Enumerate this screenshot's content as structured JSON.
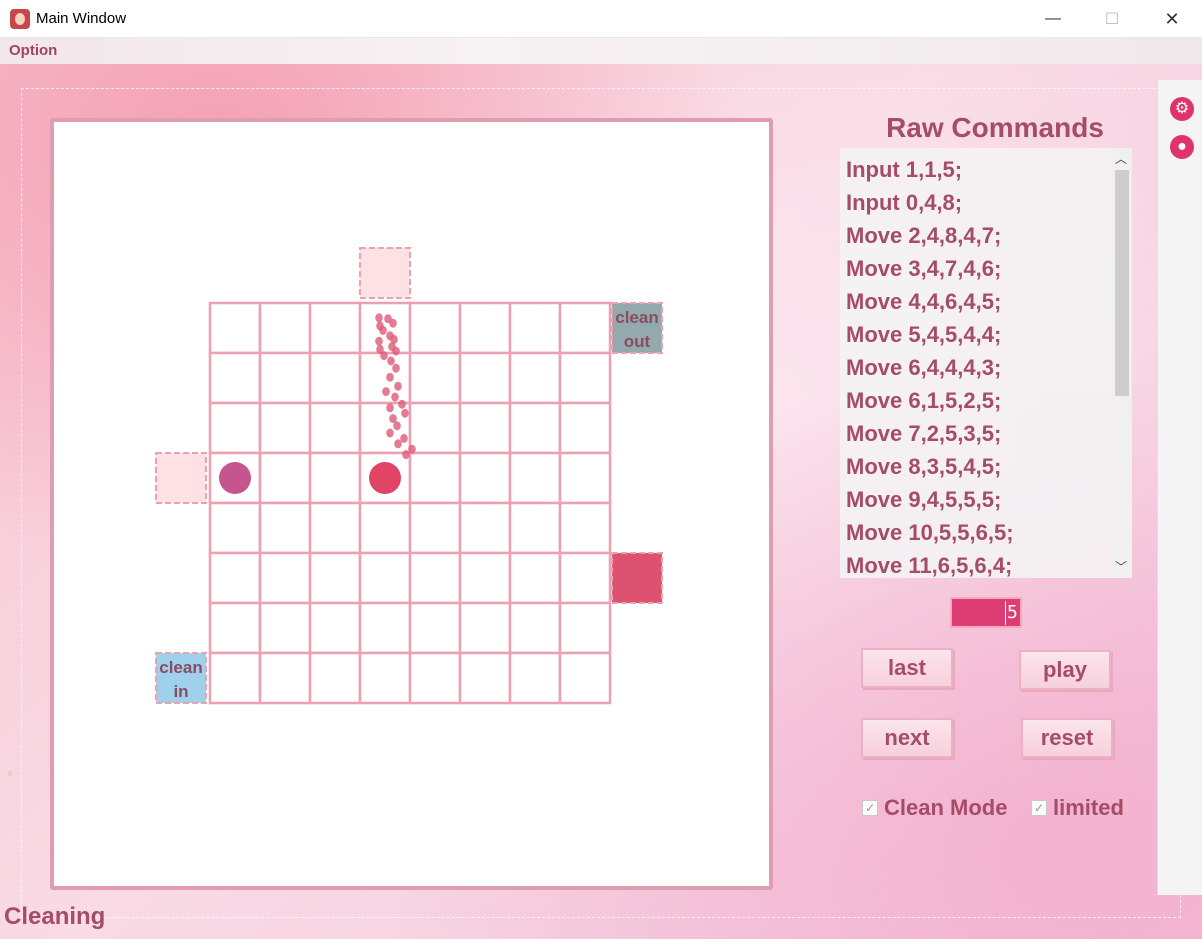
{
  "window": {
    "title": "Main Window",
    "minimize_glyph": "—",
    "maximize_glyph": "☐",
    "close_glyph": "✕"
  },
  "menu": {
    "option_label": "Option"
  },
  "board": {
    "cols": 8,
    "rows": 8,
    "clean_out_label": [
      "clean",
      "out"
    ],
    "clean_in_label": [
      "clean",
      "in"
    ],
    "colors": {
      "grid": "#eda0b0",
      "port": "#fde1e4",
      "clean_out": "#94a9ad",
      "clean_in": "#9fd0ec",
      "output_block": "#dd5171",
      "drop_purple": "#c6558f",
      "drop_red": "#e04566",
      "trail": "#de5a78"
    }
  },
  "panel": {
    "title": "Raw Commands",
    "commands": [
      "Input 1,1,5;",
      "Input 0,4,8;",
      "Move 2,4,8,4,7;",
      "Move 3,4,7,4,6;",
      "Move 4,4,6,4,5;",
      "Move 5,4,5,4,4;",
      "Move 6,4,4,4,3;",
      "Move 6,1,5,2,5;",
      "Move 7,2,5,3,5;",
      "Move 8,3,5,4,5;",
      "Move 9,4,5,5,5;",
      "Move 10,5,5,6,5;",
      "Move 11,6,5,6,4;"
    ],
    "scroll_up": "︿",
    "scroll_down": "﹀",
    "step_value": "5",
    "last_label": "last",
    "play_label": "play",
    "next_label": "next",
    "reset_label": "reset",
    "clean_mode_label": "Clean Mode",
    "limited_label": "limited",
    "check_glyph": "✓"
  },
  "side": {
    "gear_glyph": "⚙",
    "chat_glyph": "●"
  },
  "status": {
    "text": "Cleaning"
  }
}
